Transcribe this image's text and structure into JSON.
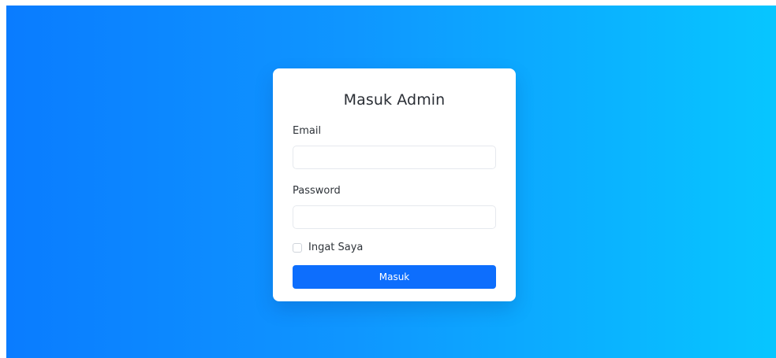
{
  "login": {
    "title": "Masuk Admin",
    "email_label": "Email",
    "email_value": "",
    "password_label": "Password",
    "password_value": "",
    "remember_label": "Ingat Saya",
    "remember_checked": false,
    "submit_label": "Masuk"
  },
  "colors": {
    "background_start": "#0a7cff",
    "background_end": "#07c6ff",
    "card": "#ffffff",
    "button": "#0d6efd"
  }
}
